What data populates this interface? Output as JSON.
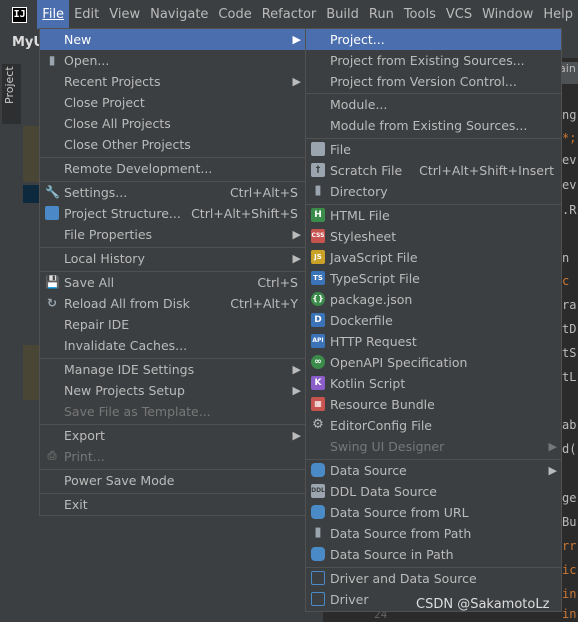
{
  "menubar": {
    "logo": "IJ",
    "items": [
      "File",
      "Edit",
      "View",
      "Navigate",
      "Code",
      "Refactor",
      "Build",
      "Run",
      "Tools",
      "VCS",
      "Window",
      "Help"
    ]
  },
  "ide": {
    "project_name": "MyU",
    "project_tab": "Project",
    "editor_tab": "lain",
    "editor_lines": [
      "ng",
      "*;",
      "ev",
      "ev",
      ".R",
      "n",
      "c",
      "ra",
      "tD",
      "tS",
      "tL",
      "ab",
      "d(",
      "ge",
      "Bu",
      "rr",
      "ic",
      "in",
      "in"
    ],
    "line_number": "24"
  },
  "file_menu": {
    "new": "New",
    "open": "Open...",
    "recent_projects": "Recent Projects",
    "close_project": "Close Project",
    "close_all_projects": "Close All Projects",
    "close_other_projects": "Close Other Projects",
    "remote_development": "Remote Development...",
    "settings": "Settings...",
    "settings_shortcut": "Ctrl+Alt+S",
    "project_structure": "Project Structure...",
    "project_structure_shortcut": "Ctrl+Alt+Shift+S",
    "file_properties": "File Properties",
    "local_history": "Local History",
    "save_all": "Save All",
    "save_all_shortcut": "Ctrl+S",
    "reload_all": "Reload All from Disk",
    "reload_all_shortcut": "Ctrl+Alt+Y",
    "repair_ide": "Repair IDE",
    "invalidate_caches": "Invalidate Caches...",
    "manage_ide_settings": "Manage IDE Settings",
    "new_projects_setup": "New Projects Setup",
    "save_file_as_template": "Save File as Template...",
    "export": "Export",
    "print": "Print...",
    "power_save_mode": "Power Save Mode",
    "exit": "Exit"
  },
  "new_submenu": {
    "project": "Project...",
    "project_existing": "Project from Existing Sources...",
    "project_vcs": "Project from Version Control...",
    "module": "Module...",
    "module_existing": "Module from Existing Sources...",
    "file": "File",
    "scratch_file": "Scratch File",
    "scratch_shortcut": "Ctrl+Alt+Shift+Insert",
    "directory": "Directory",
    "html_file": "HTML File",
    "stylesheet": "Stylesheet",
    "js_file": "JavaScript File",
    "ts_file": "TypeScript File",
    "package_json": "package.json",
    "dockerfile": "Dockerfile",
    "http_request": "HTTP Request",
    "openapi": "OpenAPI Specification",
    "kotlin_script": "Kotlin Script",
    "resource_bundle": "Resource Bundle",
    "editorconfig": "EditorConfig File",
    "swing_designer": "Swing UI Designer",
    "data_source": "Data Source",
    "ddl_data_source": "DDL Data Source",
    "ds_from_url": "Data Source from URL",
    "ds_from_path": "Data Source from Path",
    "ds_in_path": "Data Source in Path",
    "driver_and_ds": "Driver and Data Source",
    "driver": "Driver"
  },
  "watermark": "CSDN @SakamotoLz",
  "colors": {
    "selection": "#4b6eaf",
    "menu_bg": "#3c3f41",
    "text": "#bbbbbb",
    "disabled": "#777777"
  }
}
